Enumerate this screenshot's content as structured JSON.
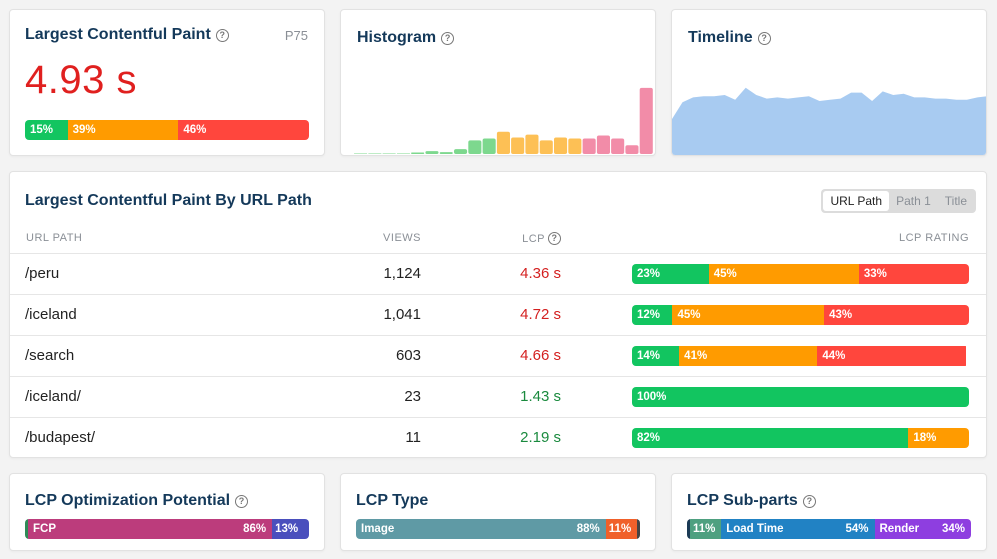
{
  "lcp_card": {
    "title": "Largest Contentful Paint",
    "percentile": "P75",
    "value": "4.93 s",
    "rating": [
      {
        "label": "15%",
        "pct": 15,
        "kind": "good"
      },
      {
        "label": "39%",
        "pct": 39,
        "kind": "ni"
      },
      {
        "label": "46%",
        "pct": 46,
        "kind": "poor"
      }
    ]
  },
  "histogram_card": {
    "title": "Histogram"
  },
  "timeline_card": {
    "title": "Timeline"
  },
  "chart_data": [
    {
      "type": "bar",
      "title": "Histogram",
      "xlabel": "",
      "ylabel": "",
      "values": [
        0.5,
        0.5,
        0.5,
        0.5,
        1.5,
        3,
        2,
        5,
        14,
        16,
        23,
        17,
        20,
        14,
        17,
        16,
        16,
        19,
        16,
        9,
        68
      ],
      "colors": [
        "good",
        "good",
        "good",
        "good",
        "good",
        "good",
        "good",
        "good",
        "good",
        "good",
        "ni",
        "ni",
        "ni",
        "ni",
        "ni",
        "ni",
        "poor",
        "poor",
        "poor",
        "poor",
        "poor"
      ],
      "palette": {
        "good": "#7dd88e",
        "ni": "#fdc055",
        "poor": "#f28ca8"
      },
      "ylim": [
        0,
        70
      ]
    },
    {
      "type": "area",
      "title": "Timeline",
      "values": [
        30,
        44,
        48,
        49,
        49,
        50,
        46,
        56,
        50,
        47,
        48,
        47,
        48,
        49,
        45,
        46,
        47,
        52,
        52,
        45,
        53,
        50,
        51,
        48,
        48,
        47,
        47,
        46,
        46,
        48,
        49
      ],
      "color": "#a8cbf1",
      "ylim": [
        0,
        100
      ]
    }
  ],
  "table_card": {
    "title": "Largest Contentful Paint By URL Path",
    "toggle": [
      "URL Path",
      "Path 1",
      "Title"
    ],
    "toggle_active": 0,
    "headers": {
      "path": "URL PATH",
      "views": "VIEWS",
      "lcp": "LCP",
      "rating": "LCP RATING"
    },
    "rows": [
      {
        "path": "/peru",
        "views": "1,124",
        "lcp": "4.36 s",
        "status": "bad",
        "rating": [
          {
            "label": "23%",
            "pct": 23,
            "kind": "good"
          },
          {
            "label": "45%",
            "pct": 45,
            "kind": "ni"
          },
          {
            "label": "33%",
            "pct": 33,
            "kind": "poor"
          }
        ]
      },
      {
        "path": "/iceland",
        "views": "1,041",
        "lcp": "4.72 s",
        "status": "bad",
        "rating": [
          {
            "label": "12%",
            "pct": 12,
            "kind": "good"
          },
          {
            "label": "45%",
            "pct": 45,
            "kind": "ni"
          },
          {
            "label": "43%",
            "pct": 43,
            "kind": "poor"
          }
        ]
      },
      {
        "path": "/search",
        "views": "603",
        "lcp": "4.66 s",
        "status": "bad",
        "rating": [
          {
            "label": "14%",
            "pct": 14,
            "kind": "good"
          },
          {
            "label": "41%",
            "pct": 41,
            "kind": "ni"
          },
          {
            "label": "44%",
            "pct": 44,
            "kind": "poor"
          }
        ]
      },
      {
        "path": "/iceland/",
        "views": "23",
        "lcp": "1.43 s",
        "status": "ok",
        "rating": [
          {
            "label": "100%",
            "pct": 100,
            "kind": "good"
          }
        ]
      },
      {
        "path": "/budapest/",
        "views": "11",
        "lcp": "2.19 s",
        "status": "ok",
        "rating": [
          {
            "label": "82%",
            "pct": 82,
            "kind": "good"
          },
          {
            "label": "18%",
            "pct": 18,
            "kind": "ni"
          }
        ]
      }
    ]
  },
  "optimization_card": {
    "title": "LCP Optimization Potential",
    "segments": [
      {
        "name": "",
        "label": "",
        "pct": 1,
        "color": "#2e8b57"
      },
      {
        "name": "FCP",
        "label": "86%",
        "pct": 86,
        "color": "#bc3c7c"
      },
      {
        "name": "",
        "label": "13%",
        "pct": 13,
        "color": "#4a4fbd"
      }
    ]
  },
  "type_card": {
    "title": "LCP Type",
    "segments": [
      {
        "name": "Image",
        "label": "88%",
        "pct": 88,
        "color": "#5f9aa5"
      },
      {
        "name": "",
        "label": "11%",
        "pct": 11,
        "color": "#f0602a"
      },
      {
        "name": "",
        "label": "",
        "pct": 1,
        "color": "#444444"
      }
    ]
  },
  "subparts_card": {
    "title": "LCP Sub-parts",
    "segments": [
      {
        "name": "",
        "label": "",
        "pct": 1,
        "color": "#1b3a55"
      },
      {
        "name": "",
        "label": "11%",
        "pct": 11,
        "color": "#4ea080"
      },
      {
        "name": "Load Time",
        "label": "54%",
        "pct": 54,
        "color": "#2182c4"
      },
      {
        "name": "Render",
        "label": "34%",
        "pct": 34,
        "color": "#8e3ee0"
      }
    ]
  }
}
